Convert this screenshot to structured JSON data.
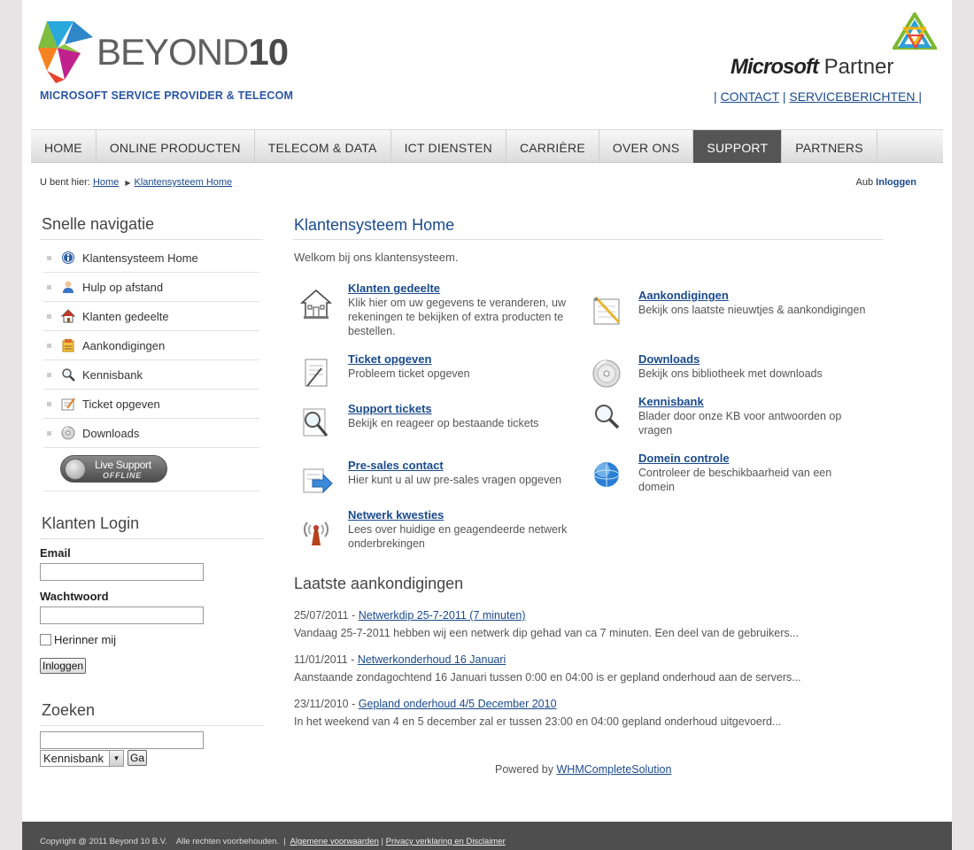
{
  "header": {
    "logo_brand": "BEYOND",
    "logo_number": "10",
    "logo_tagline": "MICROSOFT SERVICE PROVIDER & TELECOM",
    "partner_brand": "Microsoft",
    "partner_word": "Partner",
    "top_links": [
      {
        "label": "CONTACT"
      },
      {
        "label": " SERVICEBERICHTEN "
      }
    ]
  },
  "nav": {
    "items": [
      {
        "label": "HOME",
        "active": false
      },
      {
        "label": "ONLINE PRODUCTEN",
        "active": false
      },
      {
        "label": "TELECOM & DATA",
        "active": false
      },
      {
        "label": "ICT DIENSTEN",
        "active": false
      },
      {
        "label": "CARRIÈRE",
        "active": false
      },
      {
        "label": "OVER ONS",
        "active": false
      },
      {
        "label": "SUPPORT",
        "active": true
      },
      {
        "label": "PARTNERS",
        "active": false
      }
    ]
  },
  "breadcrumb": {
    "prefix": "U bent hier:",
    "home": "Home",
    "current": "Klantensysteem Home"
  },
  "login_prompt": {
    "prefix": "Aub",
    "link": "Inloggen"
  },
  "sidebar": {
    "quicknav_title": "Snelle navigatie",
    "quicknav": [
      {
        "label": "Klantensysteem Home",
        "icon": "info-icon"
      },
      {
        "label": "Hulp op afstand",
        "icon": "user-icon"
      },
      {
        "label": "Klanten gedeelte",
        "icon": "home-icon"
      },
      {
        "label": "Aankondigingen",
        "icon": "announcement-icon"
      },
      {
        "label": "Kennisbank",
        "icon": "magnifier-icon"
      },
      {
        "label": "Ticket opgeven",
        "icon": "ticket-icon"
      },
      {
        "label": "Downloads",
        "icon": "disc-icon"
      }
    ],
    "live_support": {
      "line1": "Live Support",
      "line2": "OFFLINE"
    },
    "login_title": "Klanten Login",
    "email_label": "Email",
    "email_value": "",
    "password_label": "Wachtwoord",
    "password_value": "",
    "remember_label": "Herinner mij",
    "login_button": "Inloggen",
    "search_title": "Zoeken",
    "search_value": "",
    "search_select": "Kennisbank",
    "search_button": "Ga"
  },
  "main": {
    "title": "Klantensysteem Home",
    "welcome": "Welkom bij ons klantensysteem.",
    "features": [
      {
        "title": "Klanten gedeelte",
        "desc": "Klik hier om uw gegevens te veranderen, uw rekeningen te bekijken of extra producten te bestellen.",
        "icon": "house-icon"
      },
      {
        "title": "Aankondigingen",
        "desc": "Bekijk ons laatste nieuwtjes & aankondigingen",
        "icon": "notepad-icon"
      },
      {
        "title": "Ticket opgeven",
        "desc": "Probleem ticket opgeven",
        "icon": "document-pen-icon"
      },
      {
        "title": "Downloads",
        "desc": "Bekijk ons bibliotheek met downloads",
        "icon": "cd-icon"
      },
      {
        "title": "Support tickets",
        "desc": "Bekijk en reageer op bestaande tickets",
        "icon": "search-document-icon"
      },
      {
        "title": "Kennisbank",
        "desc": "Blader door onze KB voor antwoorden op vragen",
        "icon": "magnifier-icon"
      },
      {
        "title": "Pre-sales contact",
        "desc": "Hier kunt u al uw pre-sales vragen opgeven",
        "icon": "arrow-document-icon"
      },
      {
        "title": "Domein controle",
        "desc": "Controleer de beschikbaarheid van een domein",
        "icon": "globe-icon"
      },
      {
        "title": "Netwerk kwesties",
        "desc": "Lees over huidige en geagendeerde netwerk onderbrekingen",
        "icon": "antenna-icon"
      }
    ],
    "announcements_title": "Laatste aankondigingen",
    "announcements": [
      {
        "date": "25/07/2011",
        "title": "Netwerkdip 25-7-2011 (7 minuten)",
        "summary": "Vandaag 25-7-2011 hebben wij een netwerk dip gehad van ca 7 minuten. Een deel van de gebruikers..."
      },
      {
        "date": "11/01/2011",
        "title": "Netwerkonderhoud 16 Januari",
        "summary": "Aanstaande zondagochtend 16 Januari tussen 0:00 en 04:00 is er gepland onderhoud aan de servers..."
      },
      {
        "date": "23/11/2010",
        "title": "Gepland onderhoud 4/5 December 2010",
        "summary": "In het weekend van 4 en 5 december zal er tussen 23:00 en 04:00 gepland onderhoud uitgevoerd..."
      }
    ],
    "powered_prefix": "Powered by",
    "powered_link": "WHMCompleteSolution"
  },
  "footer": {
    "copyright": "Copyright @ 2011 Beyond 10 B.V.    Alle rechten voorbehouden.",
    "links": [
      "Algemene voorwaarden",
      "Privacy verklaring en Disclaimer"
    ]
  }
}
